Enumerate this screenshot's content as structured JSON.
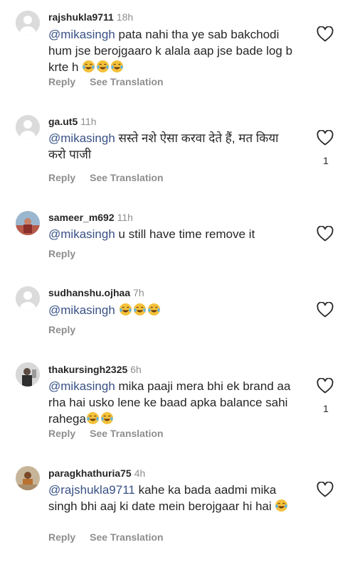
{
  "ui": {
    "reply_label": "Reply",
    "translate_label": "See Translation"
  },
  "comments": [
    {
      "username": "rajshukla9711",
      "time": "18h",
      "mention": "@mikasingh",
      "text": " pata nahi tha ye sab bakchodi hum jse berojgaaro k alala aap jse bade log b krte h ",
      "emoji_count": 3,
      "likes": "",
      "show_translation": true
    },
    {
      "username": "ga.ut5",
      "time": "11h",
      "mention": "@mikasingh",
      "text": " सस्ते नशे ऐसा करवा देते हैं, मत किया करो पाजी",
      "emoji_count": 0,
      "likes": "1",
      "show_translation": true
    },
    {
      "username": "sameer_m692",
      "time": "11h",
      "mention": "@mikasingh",
      "text": " u still have time remove it",
      "emoji_count": 0,
      "likes": "",
      "show_translation": false
    },
    {
      "username": "sudhanshu.ojhaa",
      "time": "7h",
      "mention": "@mikasingh",
      "text": " ",
      "emoji_count": 3,
      "likes": "",
      "show_translation": false
    },
    {
      "username": "thakursingh2325",
      "time": "6h",
      "mention": "@mikasingh",
      "text": " mika paaji mera bhi ek brand aa rha hai usko lene ke baad apka balance sahi rahega",
      "emoji_count": 2,
      "likes": "1",
      "show_translation": true
    },
    {
      "username": "paragkhathuria75",
      "time": "4h",
      "mention": "@rajshukla9711",
      "text": " kahe ka bada aadmi mika singh bhi aaj ki date mein berojgaar hi hai ",
      "emoji_count": 1,
      "likes": "",
      "show_translation": true
    }
  ],
  "colors": {
    "mention": "#385185",
    "muted": "#8e8e8e",
    "text": "#262626",
    "emoji": "#f4c13b"
  },
  "icons": {
    "like": "heart-outline-icon",
    "reaction": "face-with-tears-of-joy-emoji"
  }
}
